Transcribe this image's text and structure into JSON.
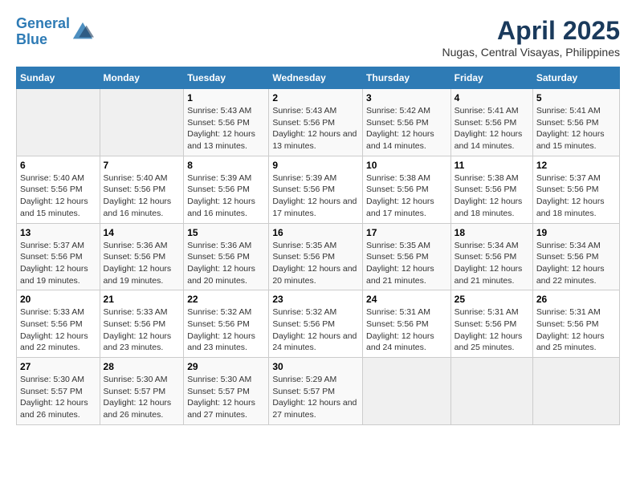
{
  "header": {
    "logo_line1": "General",
    "logo_line2": "Blue",
    "title": "April 2025",
    "subtitle": "Nugas, Central Visayas, Philippines"
  },
  "days_of_week": [
    "Sunday",
    "Monday",
    "Tuesday",
    "Wednesday",
    "Thursday",
    "Friday",
    "Saturday"
  ],
  "weeks": [
    [
      {
        "num": "",
        "empty": true
      },
      {
        "num": "",
        "empty": true
      },
      {
        "num": "1",
        "sunrise": "5:43 AM",
        "sunset": "5:56 PM",
        "daylight": "12 hours and 13 minutes."
      },
      {
        "num": "2",
        "sunrise": "5:43 AM",
        "sunset": "5:56 PM",
        "daylight": "12 hours and 13 minutes."
      },
      {
        "num": "3",
        "sunrise": "5:42 AM",
        "sunset": "5:56 PM",
        "daylight": "12 hours and 14 minutes."
      },
      {
        "num": "4",
        "sunrise": "5:41 AM",
        "sunset": "5:56 PM",
        "daylight": "12 hours and 14 minutes."
      },
      {
        "num": "5",
        "sunrise": "5:41 AM",
        "sunset": "5:56 PM",
        "daylight": "12 hours and 15 minutes."
      }
    ],
    [
      {
        "num": "6",
        "sunrise": "5:40 AM",
        "sunset": "5:56 PM",
        "daylight": "12 hours and 15 minutes."
      },
      {
        "num": "7",
        "sunrise": "5:40 AM",
        "sunset": "5:56 PM",
        "daylight": "12 hours and 16 minutes."
      },
      {
        "num": "8",
        "sunrise": "5:39 AM",
        "sunset": "5:56 PM",
        "daylight": "12 hours and 16 minutes."
      },
      {
        "num": "9",
        "sunrise": "5:39 AM",
        "sunset": "5:56 PM",
        "daylight": "12 hours and 17 minutes."
      },
      {
        "num": "10",
        "sunrise": "5:38 AM",
        "sunset": "5:56 PM",
        "daylight": "12 hours and 17 minutes."
      },
      {
        "num": "11",
        "sunrise": "5:38 AM",
        "sunset": "5:56 PM",
        "daylight": "12 hours and 18 minutes."
      },
      {
        "num": "12",
        "sunrise": "5:37 AM",
        "sunset": "5:56 PM",
        "daylight": "12 hours and 18 minutes."
      }
    ],
    [
      {
        "num": "13",
        "sunrise": "5:37 AM",
        "sunset": "5:56 PM",
        "daylight": "12 hours and 19 minutes."
      },
      {
        "num": "14",
        "sunrise": "5:36 AM",
        "sunset": "5:56 PM",
        "daylight": "12 hours and 19 minutes."
      },
      {
        "num": "15",
        "sunrise": "5:36 AM",
        "sunset": "5:56 PM",
        "daylight": "12 hours and 20 minutes."
      },
      {
        "num": "16",
        "sunrise": "5:35 AM",
        "sunset": "5:56 PM",
        "daylight": "12 hours and 20 minutes."
      },
      {
        "num": "17",
        "sunrise": "5:35 AM",
        "sunset": "5:56 PM",
        "daylight": "12 hours and 21 minutes."
      },
      {
        "num": "18",
        "sunrise": "5:34 AM",
        "sunset": "5:56 PM",
        "daylight": "12 hours and 21 minutes."
      },
      {
        "num": "19",
        "sunrise": "5:34 AM",
        "sunset": "5:56 PM",
        "daylight": "12 hours and 22 minutes."
      }
    ],
    [
      {
        "num": "20",
        "sunrise": "5:33 AM",
        "sunset": "5:56 PM",
        "daylight": "12 hours and 22 minutes."
      },
      {
        "num": "21",
        "sunrise": "5:33 AM",
        "sunset": "5:56 PM",
        "daylight": "12 hours and 23 minutes."
      },
      {
        "num": "22",
        "sunrise": "5:32 AM",
        "sunset": "5:56 PM",
        "daylight": "12 hours and 23 minutes."
      },
      {
        "num": "23",
        "sunrise": "5:32 AM",
        "sunset": "5:56 PM",
        "daylight": "12 hours and 24 minutes."
      },
      {
        "num": "24",
        "sunrise": "5:31 AM",
        "sunset": "5:56 PM",
        "daylight": "12 hours and 24 minutes."
      },
      {
        "num": "25",
        "sunrise": "5:31 AM",
        "sunset": "5:56 PM",
        "daylight": "12 hours and 25 minutes."
      },
      {
        "num": "26",
        "sunrise": "5:31 AM",
        "sunset": "5:56 PM",
        "daylight": "12 hours and 25 minutes."
      }
    ],
    [
      {
        "num": "27",
        "sunrise": "5:30 AM",
        "sunset": "5:57 PM",
        "daylight": "12 hours and 26 minutes."
      },
      {
        "num": "28",
        "sunrise": "5:30 AM",
        "sunset": "5:57 PM",
        "daylight": "12 hours and 26 minutes."
      },
      {
        "num": "29",
        "sunrise": "5:30 AM",
        "sunset": "5:57 PM",
        "daylight": "12 hours and 27 minutes."
      },
      {
        "num": "30",
        "sunrise": "5:29 AM",
        "sunset": "5:57 PM",
        "daylight": "12 hours and 27 minutes."
      },
      {
        "num": "",
        "empty": true
      },
      {
        "num": "",
        "empty": true
      },
      {
        "num": "",
        "empty": true
      }
    ]
  ],
  "labels": {
    "sunrise_prefix": "Sunrise: ",
    "sunset_prefix": "Sunset: ",
    "daylight_prefix": "Daylight: "
  }
}
